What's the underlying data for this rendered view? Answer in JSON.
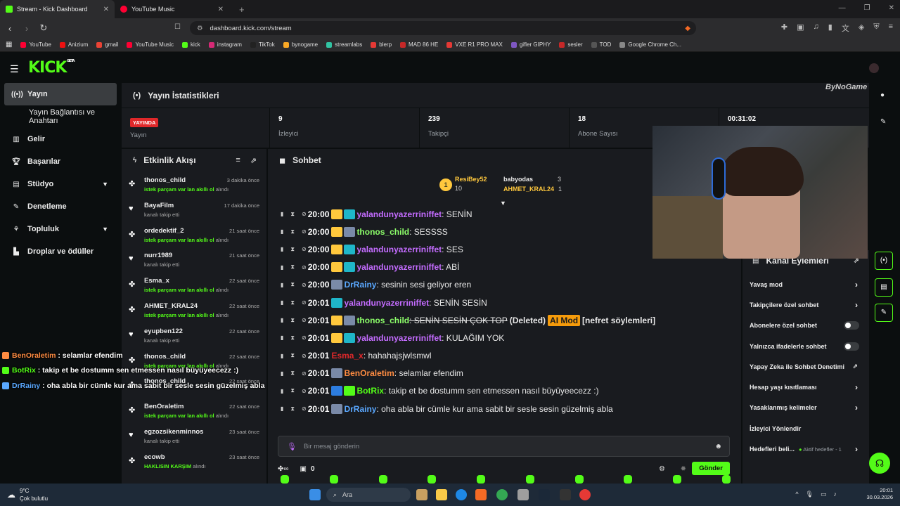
{
  "browser": {
    "tabs": [
      {
        "title": "Stream - Kick Dashboard",
        "color": "#53fc18"
      },
      {
        "title": "YouTube Music",
        "color": "#ff0033"
      }
    ],
    "url": "dashboard.kick.com/stream",
    "bookmarks": [
      {
        "label": "YouTube",
        "color": "#ff0033"
      },
      {
        "label": "Anizium",
        "color": "#e11"
      },
      {
        "label": "gmail",
        "color": "#ea4335"
      },
      {
        "label": "YouTube Music",
        "color": "#ff0033"
      },
      {
        "label": "kick",
        "color": "#53fc18"
      },
      {
        "label": "instagram",
        "color": "#d62976"
      },
      {
        "label": "TikTok",
        "color": "#222"
      },
      {
        "label": "bynogame",
        "color": "#f9a825"
      },
      {
        "label": "streamlabs",
        "color": "#31c3a2"
      },
      {
        "label": "blerp",
        "color": "#e53935"
      },
      {
        "label": "MAD 86 HE",
        "color": "#c62828"
      },
      {
        "label": "VXE R1 PRO MAX",
        "color": "#e53935"
      },
      {
        "label": "gifler GIPHY",
        "color": "#7e57c2"
      },
      {
        "label": "sesler",
        "color": "#c62828"
      },
      {
        "label": "TOD",
        "color": "#555"
      },
      {
        "label": "Google Chrome Ch...",
        "color": "#888"
      }
    ]
  },
  "sidebar": {
    "items": [
      {
        "label": "Yayın",
        "icon": "broadcast-icon"
      },
      {
        "label": "Yayın Bağlantısı ve Anahtarı",
        "icon": ""
      },
      {
        "label": "Gelir",
        "icon": "revenue-icon"
      },
      {
        "label": "Başarılar",
        "icon": "trophy-icon"
      },
      {
        "label": "Stüdyo",
        "icon": "studio-icon"
      },
      {
        "label": "Denetleme",
        "icon": "wrench-icon"
      },
      {
        "label": "Topluluk",
        "icon": "community-icon"
      },
      {
        "label": "Droplar ve ödüller",
        "icon": "drops-icon"
      }
    ]
  },
  "stats": {
    "title": "Yayın İstatistikleri",
    "live_badge": "YAYINDA",
    "live_label": "Yayın",
    "viewers": "9",
    "viewers_label": "İzleyici",
    "followers": "239",
    "followers_label": "Takipçi",
    "subs": "18",
    "subs_label": "Abone Sayısı",
    "uptime": "00:31:02"
  },
  "events": {
    "title": "Etkinlik Akışı",
    "items": [
      {
        "name": "thonos_child",
        "desc_hl": "istek parçam var lan akıllı ol",
        "desc": "alındı",
        "time": "3 dakika önce",
        "type": "redeem"
      },
      {
        "name": "BayaFilm",
        "desc_hl": "",
        "desc": "kanalı takip etti",
        "time": "17 dakika önce",
        "type": "follow"
      },
      {
        "name": "ordedektif_2",
        "desc_hl": "istek parçam var lan akıllı ol",
        "desc": "alındı",
        "time": "21 saat önce",
        "type": "redeem"
      },
      {
        "name": "nurr1989",
        "desc_hl": "",
        "desc": "kanalı takip etti",
        "time": "21 saat önce",
        "type": "follow"
      },
      {
        "name": "Esma_x",
        "desc_hl": "istek parçam var lan akıllı ol",
        "desc": "alındı",
        "time": "22 saat önce",
        "type": "redeem"
      },
      {
        "name": "AHMET_KRAL24",
        "desc_hl": "istek parçam var lan akıllı ol",
        "desc": "alındı",
        "time": "22 saat önce",
        "type": "redeem"
      },
      {
        "name": "eyupben122",
        "desc_hl": "",
        "desc": "kanalı takip etti",
        "time": "22 saat önce",
        "type": "follow"
      },
      {
        "name": "thonos_child",
        "desc_hl": "istek parçam var lan akıllı ol",
        "desc": "alındı",
        "time": "22 saat önce",
        "type": "redeem"
      },
      {
        "name": "thonos_child",
        "desc_hl": "",
        "desc": "",
        "time": "22 saat önce",
        "type": "redeem"
      },
      {
        "name": "BenOraletim",
        "desc_hl": "istek parçam var lan akıllı ol",
        "desc": "alındı",
        "time": "22 saat önce",
        "type": "redeem"
      },
      {
        "name": "egzozsikenminnos",
        "desc_hl": "",
        "desc": "kanalı takip etti",
        "time": "23 saat önce",
        "type": "follow"
      },
      {
        "name": "ecowb",
        "desc_hl": "HAKLISIN KARŞIM",
        "desc": "alındı",
        "time": "23 saat önce",
        "type": "redeem"
      }
    ]
  },
  "chat": {
    "title": "Sohbet",
    "pinned": [
      {
        "name": "ResiBey52",
        "count": "10"
      },
      {
        "name": "babyodas",
        "count": "3"
      },
      {
        "name": "AHMET_KRAL24",
        "count": "1"
      }
    ],
    "messages": [
      {
        "time": "20:00",
        "user": "yalandunyazerriniffet",
        "color": "#c46cff",
        "text": ": SENİN",
        "badges": [
          "crown",
          "sub"
        ]
      },
      {
        "time": "20:00",
        "user": "thonos_child",
        "color": "#8dff6a",
        "text": ": SESSSS",
        "badges": [
          "crown",
          "avatar"
        ]
      },
      {
        "time": "20:00",
        "user": "yalandunyazerriniffet",
        "color": "#c46cff",
        "text": ": SES",
        "badges": [
          "crown",
          "sub"
        ]
      },
      {
        "time": "20:00",
        "user": "yalandunyazerriniffet",
        "color": "#c46cff",
        "text": ": ABİ",
        "badges": [
          "crown",
          "sub"
        ]
      },
      {
        "time": "20:00",
        "user": "DrRainy",
        "color": "#5aa8ff",
        "text": ": sesinin sesi geliyor eren",
        "badges": [
          "avatar"
        ]
      },
      {
        "time": "20:01",
        "user": "yalandunyazerriniffet",
        "color": "#c46cff",
        "text": ": SENİN SESİN",
        "badges": [
          "sub"
        ]
      },
      {
        "time": "20:01",
        "user": "thonos_child",
        "color": "#8dff6a",
        "text": ": SENİN SESİN ÇOK TOP",
        "deleted": "(Deleted)",
        "mod": "AI Mod",
        "reason": "[nefret söylemleri]",
        "badges": [
          "crown",
          "avatar"
        ]
      },
      {
        "time": "20:01",
        "user": "yalandunyazerriniffet",
        "color": "#c46cff",
        "text": ": KULAĞIM YOK",
        "badges": [
          "crown",
          "sub"
        ]
      },
      {
        "time": "20:01",
        "user": "Esma_x",
        "color": "#e0282a",
        "text": ": hahahajsjwlsmwl",
        "badges": []
      },
      {
        "time": "20:01",
        "user": "BenOraletim",
        "color": "#ff8c42",
        "text": ": selamlar efendim",
        "badges": [
          "avatar"
        ]
      },
      {
        "time": "20:01",
        "user": "BotRix",
        "color": "#53fc18",
        "text": ": takip et be dostumm sen etmessen nasıl büyüyeecezz :)",
        "badges": [
          "bot",
          "verified"
        ]
      },
      {
        "time": "20:01",
        "user": "DrRainy",
        "color": "#5aa8ff",
        "text": ": oha abla bir cümle kur ama sabit bir sesle sesin güzelmiş abla",
        "badges": [
          "avatar"
        ]
      }
    ],
    "input_placeholder": "Bir mesaj gönderin",
    "points": "0",
    "send_label": "Gönder"
  },
  "overlay": [
    {
      "user": "BenOraletim",
      "color": "#ff8c42",
      "text": " : selamlar efendim"
    },
    {
      "user": "BotRix",
      "color": "#53fc18",
      "text": " : takip et be dostumm sen etmessen nasıl büyüyeecezz :)"
    },
    {
      "user": "DrRainy",
      "color": "#5aa8ff",
      "text": " : oha abla bir cümle kur ama sabit bir sesle sesin güzelmiş abla"
    }
  ],
  "watermark": "ByNoGame",
  "actions": {
    "title": "Kanal Eylemleri",
    "items": [
      {
        "label": "Yavaş mod",
        "kind": "chevron"
      },
      {
        "label": "Takipçilere özel sohbet",
        "kind": "chevron"
      },
      {
        "label": "Abonelere özel sohbet",
        "kind": "toggle"
      },
      {
        "label": "Yalnızca ifadelerle sohbet",
        "kind": "toggle"
      },
      {
        "label": "Yapay Zeka ile Sohbet Denetimi",
        "kind": "external"
      },
      {
        "label": "Hesap yaşı kısıtlaması",
        "kind": "chevron"
      },
      {
        "label": "Yasaklanmış kelimeler",
        "kind": "chevron"
      },
      {
        "label": "İzleyici Yönlendir",
        "kind": "none"
      },
      {
        "label": "Hedefleri beli...",
        "kind": "chevron",
        "sub": "Aktif hedefler - 1"
      }
    ]
  },
  "taskbar": {
    "temp": "9°C",
    "weather": "Çok bulutlu",
    "search": "Ara",
    "time": "20:01",
    "date": "30.03.2026"
  }
}
